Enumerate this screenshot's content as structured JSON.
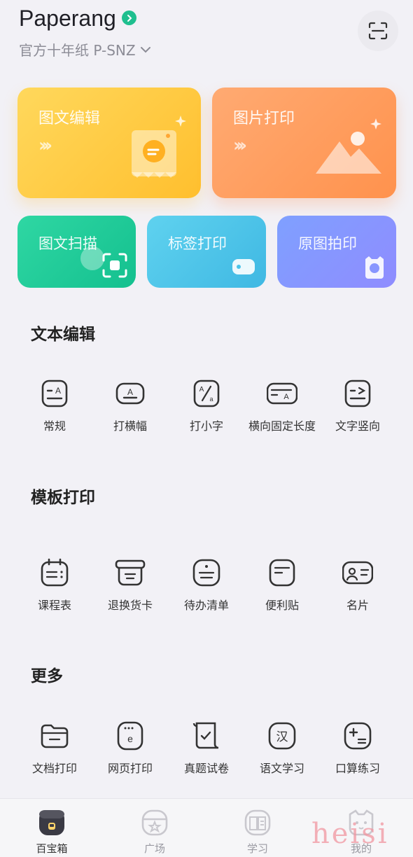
{
  "header": {
    "app_title": "Paperang",
    "device_name": "官方十年纸 P-SNZ"
  },
  "cards": {
    "edit": "图文编辑",
    "photo": "图片打印",
    "scan": "图文扫描",
    "label": "标签打印",
    "original": "原图拍印"
  },
  "sections": {
    "text_edit": {
      "title": "文本编辑",
      "items": [
        "常规",
        "打横幅",
        "打小字",
        "横向固定长度",
        "文字竖向"
      ]
    },
    "template": {
      "title": "模板打印",
      "items": [
        "课程表",
        "退换货卡",
        "待办清单",
        "便利贴",
        "名片"
      ]
    },
    "more": {
      "title": "更多",
      "items": [
        "文档打印",
        "网页打印",
        "真题试卷",
        "语文学习",
        "口算练习"
      ]
    }
  },
  "tabbar": {
    "items": [
      "百宝箱",
      "广场",
      "学习",
      "我的"
    ],
    "active": "百宝箱"
  },
  "watermark": "heisi",
  "colors": {
    "accent_green": "#1fbf8f",
    "edit_card": "#ffc83a",
    "photo_card": "#ff9a55",
    "scan_card": "#1fc897",
    "label_card": "#4cc3e8",
    "original_card": "#8896ff"
  }
}
